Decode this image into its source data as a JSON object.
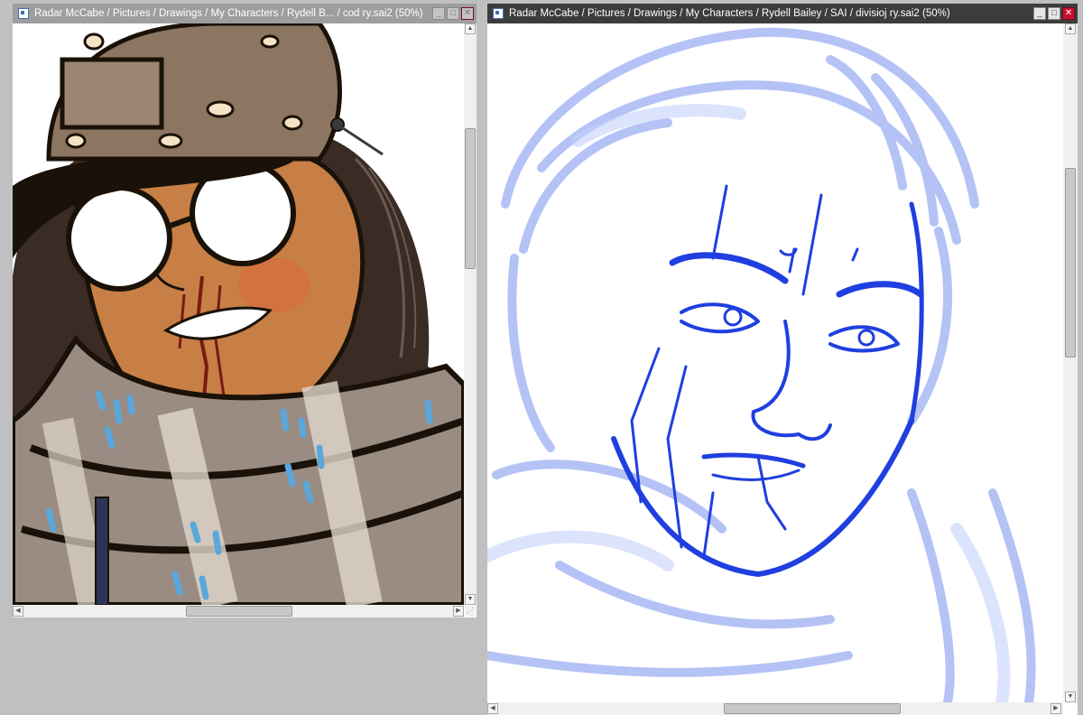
{
  "left_window": {
    "title": "Radar McCabe / Pictures / Drawings / My Characters / Rydell B...  / cod ry.sai2 (50%)",
    "state": "inactive"
  },
  "right_window": {
    "title": "Radar McCabe / Pictures / Drawings / My Characters / Rydell Bailey / SAI / divisioj ry.sai2 (50%)",
    "state": "active"
  },
  "window_controls": {
    "minimize": "_",
    "maximize": "□",
    "close": "✕"
  },
  "scroll_glyphs": {
    "up": "▲",
    "down": "▼",
    "left": "◀",
    "right": "▶",
    "grip": "⋰"
  },
  "icons": {
    "app": "sai-document-icon",
    "minimize": "minimize-icon",
    "maximize": "maximize-icon",
    "close": "close-icon"
  },
  "colors": {
    "workspace": "#c0c0c0",
    "active_titlebar": "#3c3c3c",
    "inactive_titlebar": "#9e9e9e",
    "close_button": "#c8102e",
    "sketch_blue": "#1f3fe0",
    "sketch_light_blue": "#a8b8f5",
    "skin": "#c77f45",
    "camo_brown": "#7a6450"
  }
}
